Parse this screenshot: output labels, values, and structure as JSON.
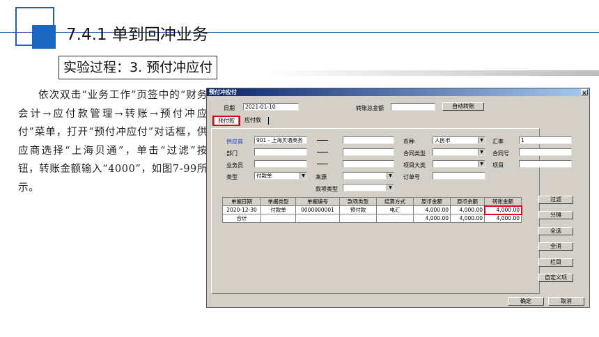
{
  "slide": {
    "title": "7.4.1  单到回冲业务",
    "subtitle": "实验过程：3. 预付冲应付",
    "body": "依次双击“业务工作”页签中的“财务会计→应付款管理→转账→预付冲应付”菜单，打开“预付冲应付”对话框，供应商选择“上海贝通”，单击“过滤”按钮，转账金额输入“4000”，如图7-99所示。"
  },
  "dialog": {
    "title": "预付冲应付",
    "close": "×",
    "date_label": "日期",
    "date_value": "2021-01-10",
    "total_label": "转账总金额",
    "total_value": "",
    "auto_button": "自动转账",
    "tabs": [
      "预付款",
      "应付款"
    ],
    "vendor_label": "供应商",
    "vendor_value": "901 - 上海贝通商务",
    "dept_label": "部门",
    "staff_label": "业务员",
    "type_label": "类型",
    "type_value": "付款单",
    "source_label": "来源",
    "fund_type_label": "款项类型",
    "currency_label": "币种",
    "currency_value": "人民币",
    "contract_type_label": "合同类型",
    "project_class_label": "项目大类",
    "order_label": "订单号",
    "rate_label": "汇率",
    "rate_value": "1",
    "contract_no_label": "合同号",
    "project_label": "项目",
    "dropdown_arrow": "▼",
    "grid": {
      "headers": [
        "单据日期",
        "单据类型",
        "单据编号",
        "款项类型",
        "结算方式",
        "原币金额",
        "原币余额",
        "转账金额"
      ],
      "rows": [
        [
          "2020-12-30",
          "付款单",
          "0000000001",
          "预付款",
          "电汇",
          "4,000.00",
          "4,000.00",
          "4,000.00"
        ]
      ],
      "total_label": "合计",
      "total_amount": "4,000.00",
      "total_balance": "4,000.00",
      "total_transfer": "4,000.00"
    },
    "side_buttons": [
      "过滤",
      "分摊",
      "全选",
      "全消",
      "栏目",
      "自定义项"
    ],
    "ok_button": "确定",
    "cancel_button": "取消"
  }
}
